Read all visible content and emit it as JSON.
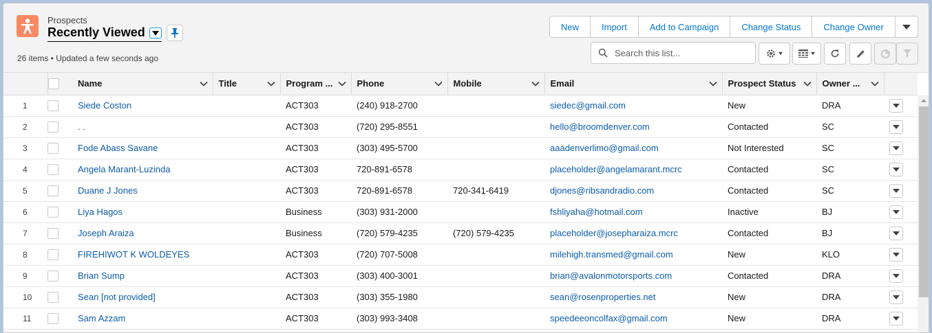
{
  "header": {
    "object_label": "Prospects",
    "list_view_title": "Recently Viewed",
    "meta_text": "26 items • Updated a few seconds ago",
    "icon": "prospect-icon",
    "accent": "#f88962"
  },
  "actions": {
    "new": "New",
    "import": "Import",
    "add_to_campaign": "Add to Campaign",
    "change_status": "Change Status",
    "change_owner": "Change Owner"
  },
  "search": {
    "placeholder": "Search this list..."
  },
  "columns": {
    "name": "Name",
    "title": "Title",
    "program": "Program ...",
    "phone": "Phone",
    "mobile": "Mobile",
    "email": "Email",
    "status": "Prospect Status",
    "owner": "Owner ..."
  },
  "rows": [
    {
      "n": "1",
      "name": "Siede Coston",
      "title": "",
      "program": "ACT303",
      "phone": "(240) 918-2700",
      "mobile": "",
      "email": "siedec@gmail.com",
      "status": "New",
      "owner": "DRA"
    },
    {
      "n": "2",
      "name": ". .",
      "title": "",
      "program": "ACT303",
      "phone": "(720) 295-8551",
      "mobile": "",
      "email": "hello@broomdenver.com",
      "status": "Contacted",
      "owner": "SC"
    },
    {
      "n": "3",
      "name": "Fode Abass Savane",
      "title": "",
      "program": "ACT303",
      "phone": "(303) 495-5700",
      "mobile": "",
      "email": "aaadenverlimo@gmail.com",
      "status": "Not Interested",
      "owner": "SC"
    },
    {
      "n": "4",
      "name": "Angela Marant-Luzinda",
      "title": "",
      "program": "ACT303",
      "phone": "720-891-6578",
      "mobile": "",
      "email": "placeholder@angelamarant.mcrc",
      "status": "Contacted",
      "owner": "SC"
    },
    {
      "n": "5",
      "name": "Duane J Jones",
      "title": "",
      "program": "ACT303",
      "phone": "720-891-6578",
      "mobile": "720-341-6419",
      "email": "djones@ribsandradio.com",
      "status": "Contacted",
      "owner": "SC"
    },
    {
      "n": "6",
      "name": "Liya Hagos",
      "title": "",
      "program": "Business",
      "phone": "(303) 931-2000",
      "mobile": "",
      "email": "fshliyaha@hotmail.com",
      "status": "Inactive",
      "owner": "BJ"
    },
    {
      "n": "7",
      "name": "Joseph Araiza",
      "title": "",
      "program": "Business",
      "phone": "(720) 579-4235",
      "mobile": "(720) 579-4235",
      "email": "placeholder@josepharaiza.mcrc",
      "status": "Contacted",
      "owner": "BJ"
    },
    {
      "n": "8",
      "name": "FIREHIWOT K WOLDEYES",
      "title": "",
      "program": "ACT303",
      "phone": "(720) 707-5008",
      "mobile": "",
      "email": "milehigh.transmed@gmail.com",
      "status": "New",
      "owner": "KLO"
    },
    {
      "n": "9",
      "name": "Brian Sump",
      "title": "",
      "program": "ACT303",
      "phone": "(303) 400-3001",
      "mobile": "",
      "email": "brian@avalonmotorsports.com",
      "status": "Contacted",
      "owner": "DRA"
    },
    {
      "n": "10",
      "name": "Sean [not provided]",
      "title": "",
      "program": "ACT303",
      "phone": "(303) 355-1980",
      "mobile": "",
      "email": "sean@rosenproperties.net",
      "status": "New",
      "owner": "DRA"
    },
    {
      "n": "11",
      "name": "Sam Azzam",
      "title": "",
      "program": "ACT303",
      "phone": "(303) 993-3408",
      "mobile": "",
      "email": "speedeeoncolfax@gmail.com",
      "status": "New",
      "owner": "DRA"
    }
  ]
}
